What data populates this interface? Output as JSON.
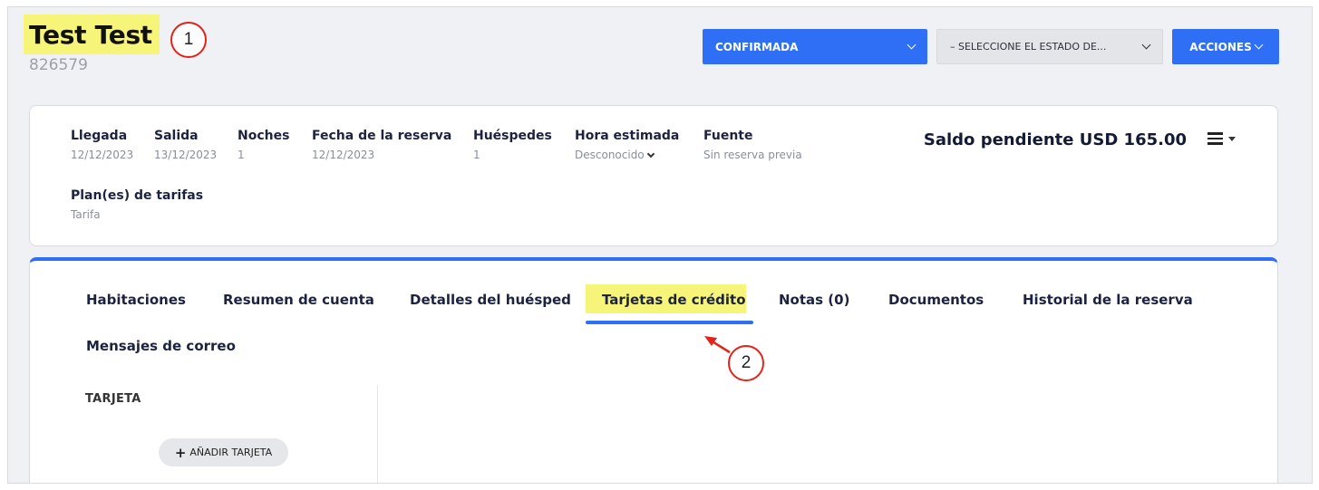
{
  "header": {
    "guest_name": "Test Test",
    "reservation_number": "826579",
    "status_button": "CONFIRMADA",
    "select_status": "– SELECCIONE EL ESTADO DE...",
    "actions_button": "ACCIONES"
  },
  "callouts": [
    "1",
    "2"
  ],
  "info": {
    "items": [
      {
        "label": "Llegada",
        "value": "12/12/2023"
      },
      {
        "label": "Salida",
        "value": "13/12/2023"
      },
      {
        "label": "Noches",
        "value": "1"
      },
      {
        "label": "Fecha de la reserva",
        "value": "12/12/2023"
      },
      {
        "label": "Huéspedes",
        "value": "1"
      },
      {
        "label": "Hora estimada",
        "value": "Desconocido"
      },
      {
        "label": "Fuente",
        "value": "Sin reserva previa"
      },
      {
        "label": "Plan(es) de tarifas",
        "value": "Tarifa"
      }
    ],
    "balance": "Saldo pendiente USD 165.00"
  },
  "tabs": [
    {
      "label": "Habitaciones"
    },
    {
      "label": "Resumen de cuenta"
    },
    {
      "label": "Detalles del huésped"
    },
    {
      "label": "Tarjetas de crédito",
      "active": true
    },
    {
      "label": "Notas (0)"
    },
    {
      "label": "Documentos"
    },
    {
      "label": "Historial de la reserva"
    },
    {
      "label": "Mensajes de correo"
    }
  ],
  "cards_section": {
    "title": "TARJETA",
    "add_button": "AÑADIR TARJETA"
  },
  "colors": {
    "primary": "#2f6ff6",
    "highlight": "#f6f57a",
    "callout_red": "#e2231a"
  }
}
